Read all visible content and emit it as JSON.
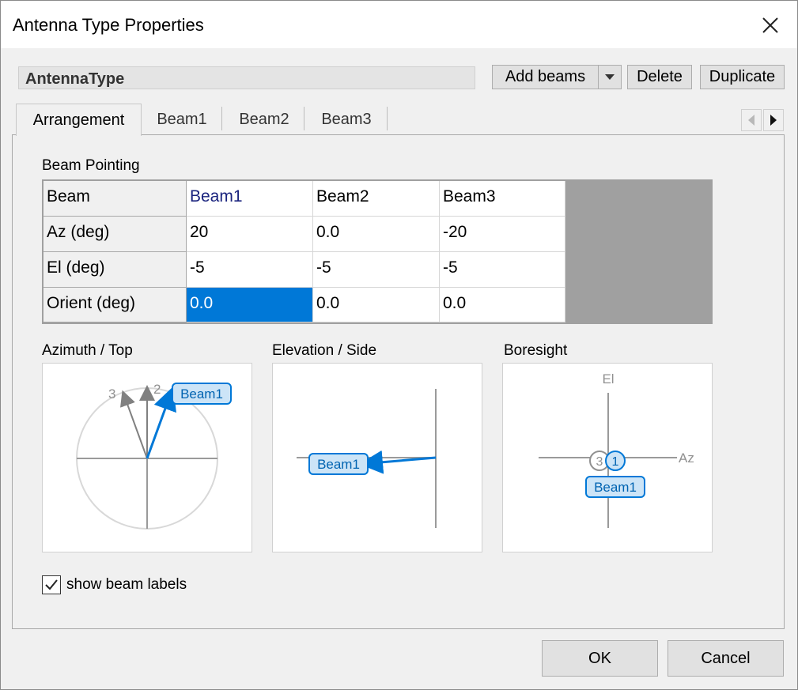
{
  "window": {
    "title": "Antenna Type Properties"
  },
  "name_field": {
    "value": "AntennaType"
  },
  "toolbar": {
    "add_beams": "Add beams",
    "delete": "Delete",
    "duplicate": "Duplicate"
  },
  "tabs": [
    {
      "label": "Arrangement",
      "active": true
    },
    {
      "label": "Beam1"
    },
    {
      "label": "Beam2"
    },
    {
      "label": "Beam3"
    }
  ],
  "beam_pointing": {
    "title": "Beam Pointing",
    "row_headers": [
      "Beam",
      "Az (deg)",
      "El (deg)",
      "Orient (deg)"
    ],
    "columns": [
      {
        "name": "Beam1",
        "az": "20",
        "el": "-5",
        "orient": "0.0"
      },
      {
        "name": "Beam2",
        "az": "0.0",
        "el": "-5",
        "orient": "0.0"
      },
      {
        "name": "Beam3",
        "az": "-20",
        "el": "-5",
        "orient": "0.0"
      }
    ],
    "selected_cell": "Beam1 Orient (deg)"
  },
  "views": {
    "azimuth": {
      "title": "Azimuth / Top",
      "label_3": "3",
      "label_2": "2",
      "beam_label": "Beam1"
    },
    "elevation": {
      "title": "Elevation / Side",
      "beam_label": "Beam1"
    },
    "boresight": {
      "title": "Boresight",
      "el_label": "El",
      "az_label": "Az",
      "marker_3": "3",
      "marker_1": "1",
      "beam_label": "Beam1"
    }
  },
  "show_labels": {
    "label": "show beam labels",
    "checked": true
  },
  "footer": {
    "ok": "OK",
    "cancel": "Cancel"
  },
  "colors": {
    "accent": "#0078d7",
    "label_fill": "#cce4f7",
    "gray_line": "#808080"
  }
}
